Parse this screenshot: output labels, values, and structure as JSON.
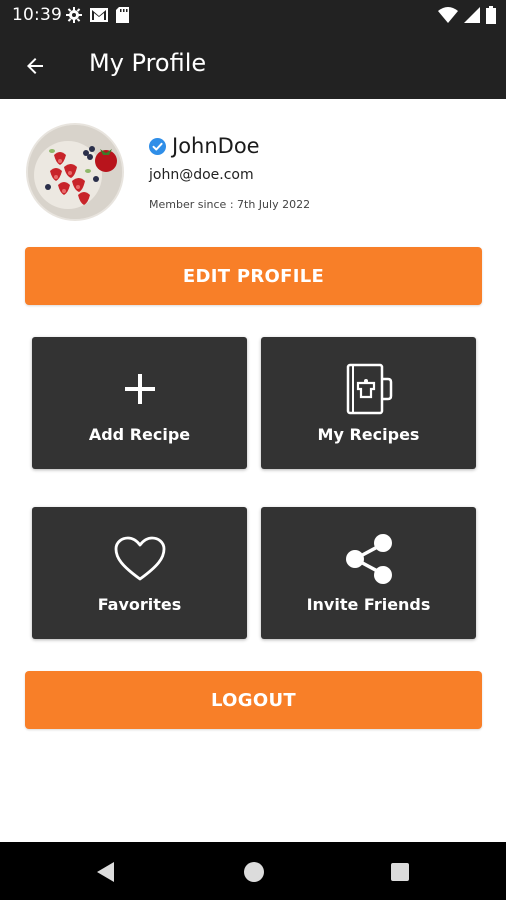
{
  "status_bar": {
    "time": "10:39",
    "left_icons": [
      "settings-icon",
      "gmail-icon",
      "sd-card-icon"
    ],
    "right_icons": [
      "wifi-icon",
      "signal-icon",
      "battery-icon"
    ]
  },
  "app_bar": {
    "title": "My Profile",
    "back_icon": "arrow-back-icon"
  },
  "profile": {
    "name": "JohnDoe",
    "email": "john@doe.com",
    "member_since": "Member since : 7th July 2022",
    "verified": true
  },
  "buttons": {
    "edit_profile": "EDIT PROFILE",
    "logout": "LOGOUT"
  },
  "tiles": [
    {
      "label": "Add Recipe",
      "icon": "plus-icon"
    },
    {
      "label": "My Recipes",
      "icon": "recipe-book-icon"
    },
    {
      "label": "Favorites",
      "icon": "heart-icon"
    },
    {
      "label": "Invite Friends",
      "icon": "share-icon"
    }
  ],
  "colors": {
    "accent": "#f87f28",
    "bar_bg": "#222222",
    "tile_bg": "#333333",
    "verified_badge": "#2f8ee8"
  },
  "nav": [
    "back-triangle-icon",
    "home-circle-icon",
    "recents-square-icon"
  ]
}
